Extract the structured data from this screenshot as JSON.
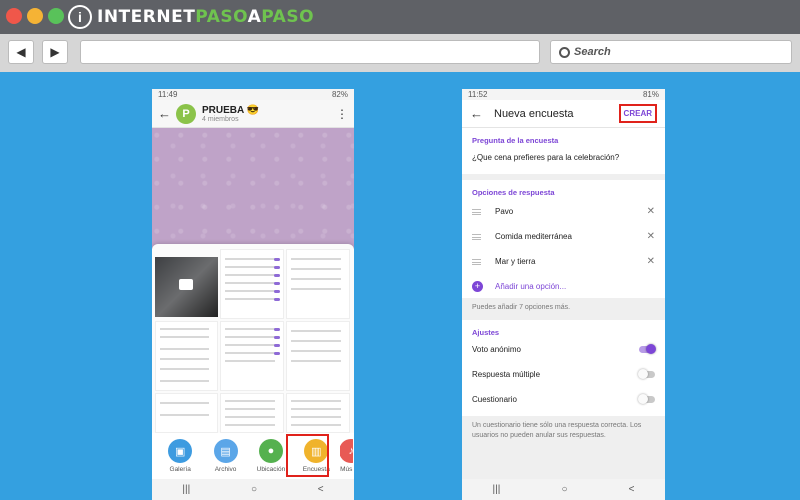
{
  "browser": {
    "logo_mark": "i",
    "logo_text_a": "INTERNET",
    "logo_text_b": "PASO",
    "logo_text_c": "A",
    "logo_text_d": "PASO",
    "back_icon": "◀",
    "forward_icon": "▶",
    "search_label": "Search"
  },
  "phone1": {
    "status_time": "11:49",
    "status_right": "82%",
    "chat_title": "PRUEBA 😎",
    "chat_subtitle": "4 miembros",
    "avatar_letter": "P",
    "attachments": [
      {
        "label": "Galería",
        "color": "#3d9be0",
        "icon": "gallery-icon"
      },
      {
        "label": "Archivo",
        "color": "#5ba6e8",
        "icon": "file-icon"
      },
      {
        "label": "Ubicación",
        "color": "#55b14f",
        "icon": "location-icon"
      },
      {
        "label": "Encuesta",
        "color": "#f0b32c",
        "icon": "poll-icon"
      },
      {
        "label": "Mús",
        "color": "#e85a55",
        "icon": "music-icon"
      }
    ]
  },
  "phone2": {
    "status_time": "11:52",
    "status_right": "81%",
    "title": "Nueva encuesta",
    "create": "CREAR",
    "question_section": "Pregunta de la encuesta",
    "question": "¿Que cena prefieres para la celebración?",
    "options_section": "Opciones de respuesta",
    "options": [
      "Pavo",
      "Comida mediterránea",
      "Mar y tierra"
    ],
    "add_option": "Añadir una opción...",
    "hint": "Puedes añadir 7 opciones más.",
    "settings_section": "Ajustes",
    "settings": [
      {
        "label": "Voto anónimo",
        "on": true
      },
      {
        "label": "Respuesta múltiple",
        "on": false
      },
      {
        "label": "Cuestionario",
        "on": false
      }
    ],
    "footnote": "Un cuestionario tiene sólo una respuesta correcta. Los usuarios no pueden anular sus respuestas."
  },
  "android_nav": [
    "|||",
    "○",
    "<"
  ]
}
